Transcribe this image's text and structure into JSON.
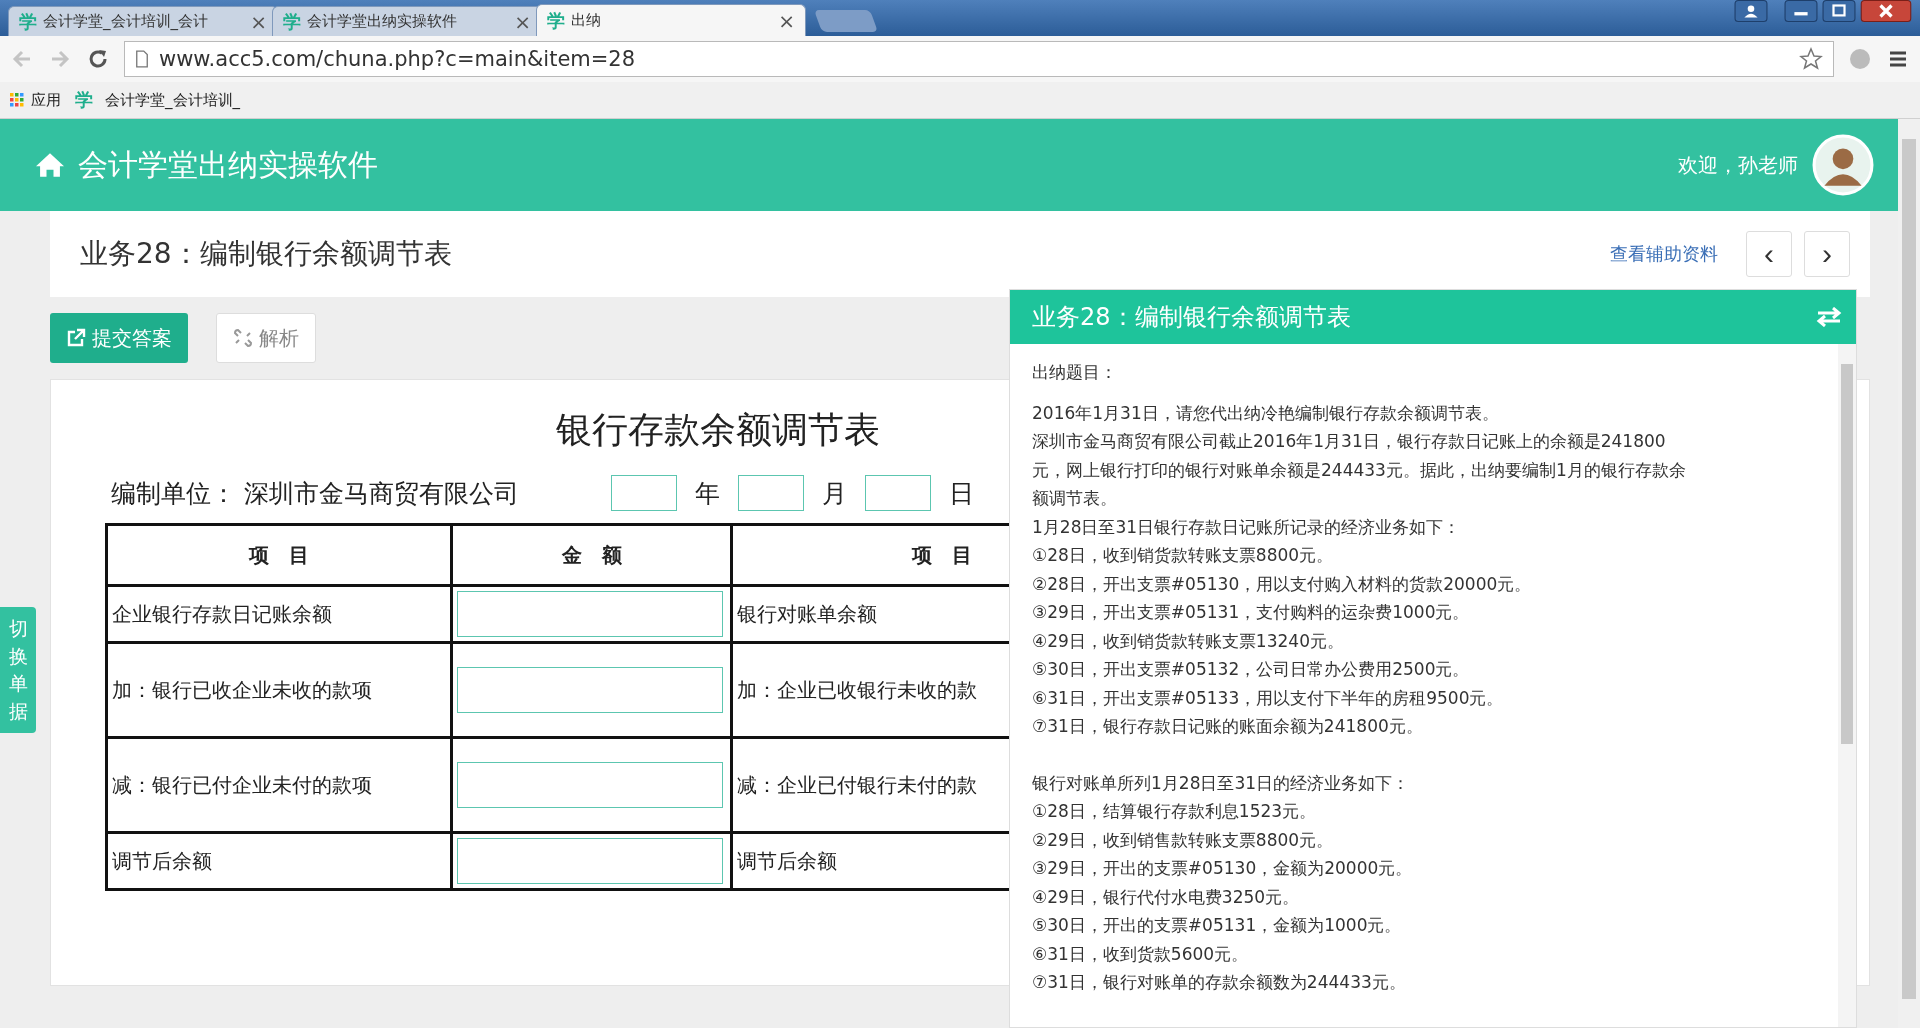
{
  "browser": {
    "tabs": [
      {
        "favicon": "学",
        "title": "会计学堂_会计培训_会计",
        "selected": false
      },
      {
        "favicon": "学",
        "title": "会计学堂出纳实操软件",
        "selected": false
      },
      {
        "favicon": "学",
        "title": "出纳",
        "selected": true
      }
    ],
    "close_glyph": "×",
    "address": "www.acc5.com/chuna.php?c=main&item=28",
    "bookmarks": [
      {
        "kind": "apps",
        "label": "应用"
      },
      {
        "kind": "site",
        "favicon": "学",
        "label": "会计学堂_会计培训_"
      }
    ]
  },
  "header": {
    "app_title": "会计学堂出纳实操软件",
    "welcome": "欢迎，孙老师"
  },
  "task_bar": {
    "title": "业务28：编制银行余额调节表",
    "link": "查看辅助资料",
    "prev": "‹",
    "next": "›"
  },
  "actions": [
    {
      "kind": "primary",
      "label": "提交答案"
    },
    {
      "kind": "secondary",
      "label": "解析"
    }
  ],
  "side_tab": "切换单据",
  "form": {
    "title": "银行存款余额调节表",
    "unit_label": "编制单位：",
    "unit": "深圳市金马商贸有限公司",
    "date_units": [
      "年",
      "月",
      "日"
    ],
    "columns": [
      "项　目",
      "金　额",
      "项　目"
    ],
    "rows": [
      {
        "left": "企业银行存款日记账余额",
        "right": "银行对账单余额"
      },
      {
        "left": "加：银行已收企业未收的款项",
        "right": "加：企业已收银行未收的款"
      },
      {
        "left": "减：银行已付企业未付的款项",
        "right": "减：企业已付银行未付的款"
      },
      {
        "left": "调节后余额",
        "right": "调节后余额"
      }
    ]
  },
  "task_panel": {
    "title": "业务28：编制银行余额调节表",
    "heading": "出纳题目：",
    "sections": [
      [
        "2016年1月31日，请您代出纳冷艳编制银行存款余额调节表。",
        "深圳市金马商贸有限公司截止2016年1月31日，银行存款日记账上的余额是241800元，网上银行打印的银行对账单余额是244433元。据此，出纳要编制1月的银行存款余额调节表。",
        "1月28日至31日银行存款日记账所记录的经济业务如下：",
        "①28日，收到销货款转账支票8800元。",
        "②28日，开出支票#05130，用以支付购入材料的货款20000元。",
        "③29日，开出支票#05131，支付购料的运杂费1000元。",
        "④29日，收到销货款转账支票13240元。",
        "⑤30日，开出支票#05132，公司日常办公费用2500元。",
        "⑥31日，开出支票#05133，用以支付下半年的房租9500元。",
        "⑦31日，银行存款日记账的账面余额为241800元。"
      ],
      [
        "银行对账单所列1月28日至31日的经济业务如下：",
        "①28日，结算银行存款利息1523元。",
        "②29日，收到销售款转账支票8800元。",
        "③29日，开出的支票#05130，金额为20000元。",
        "④29日，银行代付水电费3250元。",
        "⑤30日，开出的支票#05131，金额为1000元。",
        "⑥31日，收到货款5600元。",
        "⑦31日，银行对账单的存款余额数为244433元。"
      ]
    ]
  }
}
